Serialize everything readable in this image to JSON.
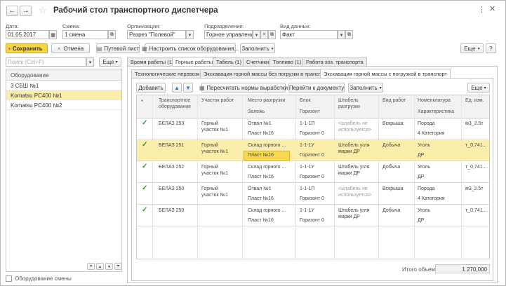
{
  "window": {
    "title": "Рабочий стол транспортного диспетчера"
  },
  "filters": {
    "date_label": "Дата:",
    "date_value": "01.05.2017",
    "shift_label": "Смена:",
    "shift_value": "1 смена",
    "org_label": "Организация:",
    "org_value": "Разрез \"Полевой\"",
    "dept_label": "Подразделение:",
    "dept_value": "Горное управление",
    "datatype_label": "Вид данных:",
    "datatype_value": "Факт"
  },
  "toolbar": {
    "save": "Сохранить",
    "cancel": "Отмена",
    "waybill": "Путевой лист",
    "setup": "Настроить список оборудования...",
    "fill": "Заполнить",
    "more": "Еще"
  },
  "left": {
    "search_placeholder": "Поиск (Ctrl+F)",
    "more": "Еще",
    "column": "Оборудование",
    "items": [
      "3 СБШ №1",
      "Komatsu PC400 №1",
      "Komatsu PC400 №2"
    ],
    "shift_equipment": "Оборудование смены"
  },
  "tabs": [
    "Время работы (1)",
    "Горные работы",
    "Табель (1)",
    "Счетчики",
    "Топливо (1)",
    "Работа хоз. транспорта"
  ],
  "subtabs": [
    "Технологические перевозки",
    "Экскавация горной массы без погрузки в транспорт",
    "Экскавация горной массы с погрузкой в транспорт"
  ],
  "grid_toolbar": {
    "add": "Добавить",
    "recalc": "Пересчитать нормы выработки",
    "goto_doc": "Перейти к документу",
    "fill": "Заполнить",
    "more": "Еще"
  },
  "columns": {
    "equipment": "Транспортное оборудование",
    "site": "Участок работ",
    "unload": "Место разгрузки",
    "bed": "Залежь",
    "block": "Блок",
    "horizon": "Горизонт",
    "stack": "Штабель разгрузки",
    "worktype": "Вид работ",
    "nomen": "Номенклатура",
    "feature": "Характеристика",
    "unit": "Ед. изм."
  },
  "rows": [
    {
      "equip": "БЕЛАЗ 253",
      "site": "Горный участок №1",
      "unload": "Отвал №1",
      "bed": "Пласт №16",
      "block": "1-1-1П",
      "horizon": "Горизонт 0",
      "stack": "<штабель не используется>",
      "work": "Вскрыша",
      "nomen": "Порода",
      "feature": "4 Категория",
      "unit": "м3_2.5т"
    },
    {
      "equip": "БЕЛАЗ 251",
      "site": "Горный участок №1",
      "unload": "Склад горного ...",
      "bed": "Пласт №16",
      "block": "1-1-1У",
      "horizon": "Горизонт 0",
      "stack": "Штабель угля марки ДР",
      "work": "Добыча",
      "nomen": "Уголь",
      "feature": "ДР",
      "unit": "т_0,741..."
    },
    {
      "equip": "БЕЛАЗ 252",
      "site": "Горный участок №1",
      "unload": "Склад горного ...",
      "bed": "Пласт №16",
      "block": "1-1-1У",
      "horizon": "Горизонт 0",
      "stack": "Штабель угля марки ДР",
      "work": "Добыча",
      "nomen": "Уголь",
      "feature": "ДР",
      "unit": "т_0,741..."
    },
    {
      "equip": "БЕЛАЗ 250",
      "site": "Горный участок №1",
      "unload": "Отвал №1",
      "bed": "Пласт №16",
      "block": "1-1-1П",
      "horizon": "Горизонт 0",
      "stack": "<штабель не используется>",
      "work": "Вскрыша",
      "nomen": "Порода",
      "feature": "4 Категория",
      "unit": "м3_2.5т"
    },
    {
      "equip": "БЕЛАЗ 250",
      "site": "",
      "unload": "Склад горного ...",
      "bed": "Пласт №16",
      "block": "1-1-1У",
      "horizon": "Горизонт 0",
      "stack": "Штабель угля марки ДР",
      "work": "Добыча",
      "nomen": "Уголь",
      "feature": "ДР",
      "unit": "т_0,741..."
    }
  ],
  "total": {
    "label": "Итого объем:",
    "value": "1 270,000"
  },
  "colors": {
    "save_yellow": "#f7d34a",
    "selected_row": "#fbeeaa",
    "current_cell": "#f8d94d",
    "check_green": "#2e9a2e"
  }
}
